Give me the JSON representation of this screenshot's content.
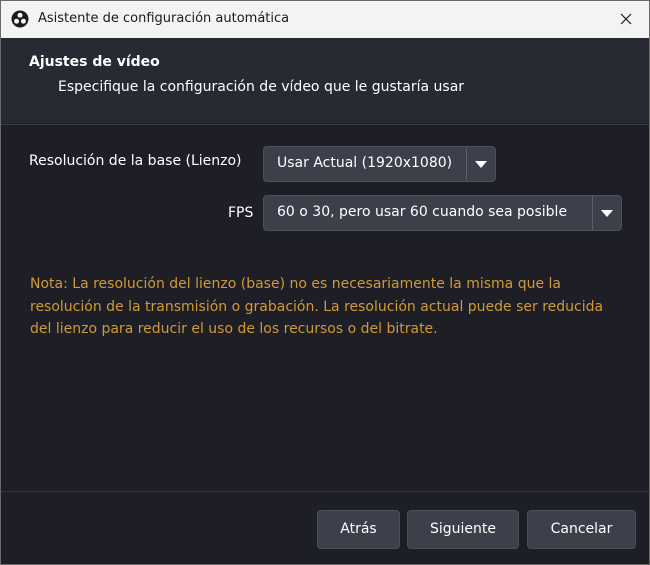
{
  "window": {
    "title": "Asistente de configuración automática"
  },
  "header": {
    "title": "Ajustes de vídeo",
    "subtitle": "Especifique la configuración de vídeo que le gustaría usar"
  },
  "form": {
    "base_resolution": {
      "label": "Resolución de la base (Lienzo)",
      "value": "Usar Actual (1920x1080)"
    },
    "fps": {
      "label": "FPS",
      "value": "60 o 30, pero usar 60 cuando sea posible"
    }
  },
  "note": "Nota: La resolución del lienzo (base) no es necesariamente la misma que la resolución de la transmisión o grabación. La resolución actual puede ser reducida del lienzo para reducir el uso de los recursos o del bitrate.",
  "buttons": {
    "back": "Atrás",
    "next": "Siguiente",
    "cancel": "Cancelar"
  },
  "colors": {
    "background": "#1d1e26",
    "header_panel": "#272a33",
    "control": "#3c404b",
    "note_text": "#d19a37",
    "titlebar": "#f3f3f3"
  },
  "icons": {
    "app": "obs-logo-icon",
    "close": "close-icon",
    "dropdown": "chevron-down-icon"
  }
}
